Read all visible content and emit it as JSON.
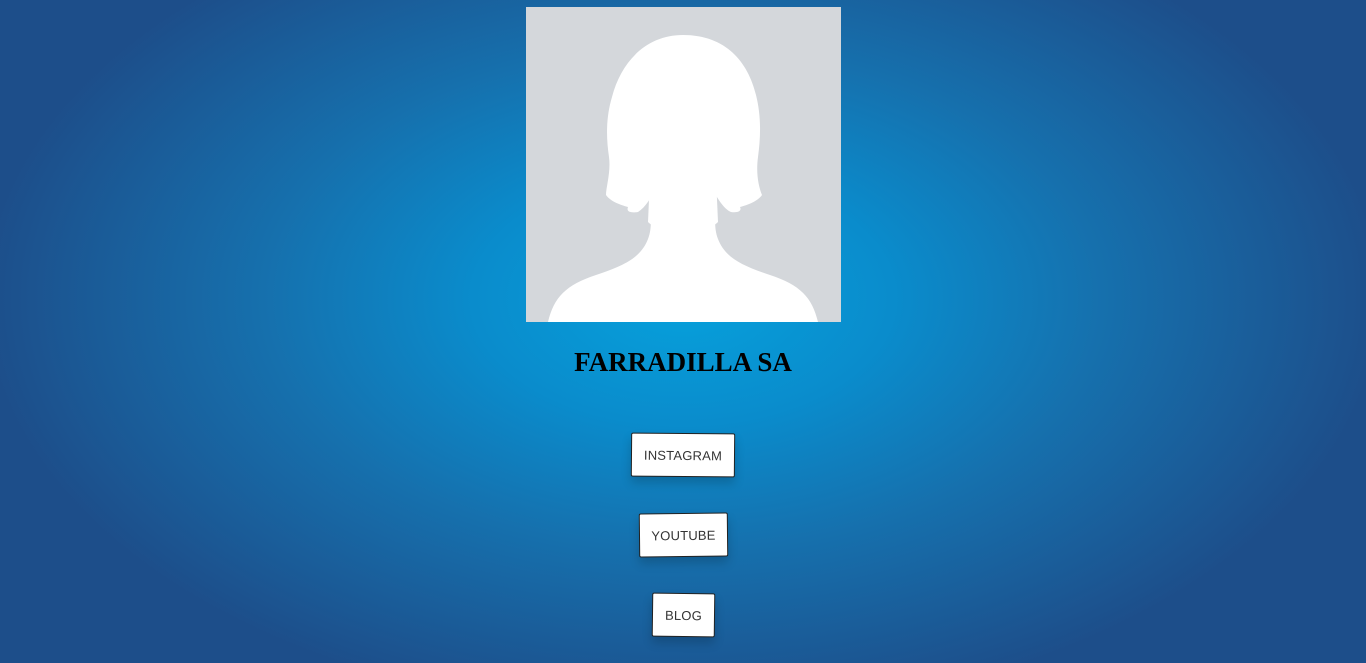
{
  "profile": {
    "name": "FARRADILLA SA",
    "avatar_icon": "default-female-avatar-icon"
  },
  "links": {
    "instagram": "INSTAGRAM",
    "youtube": "YOUTUBE",
    "blog": "BLOG"
  },
  "colors": {
    "background_center": "#06a1dc",
    "background_edge": "#1d4e8a",
    "avatar_bg": "#d4d7db",
    "button_bg": "#ffffff"
  }
}
